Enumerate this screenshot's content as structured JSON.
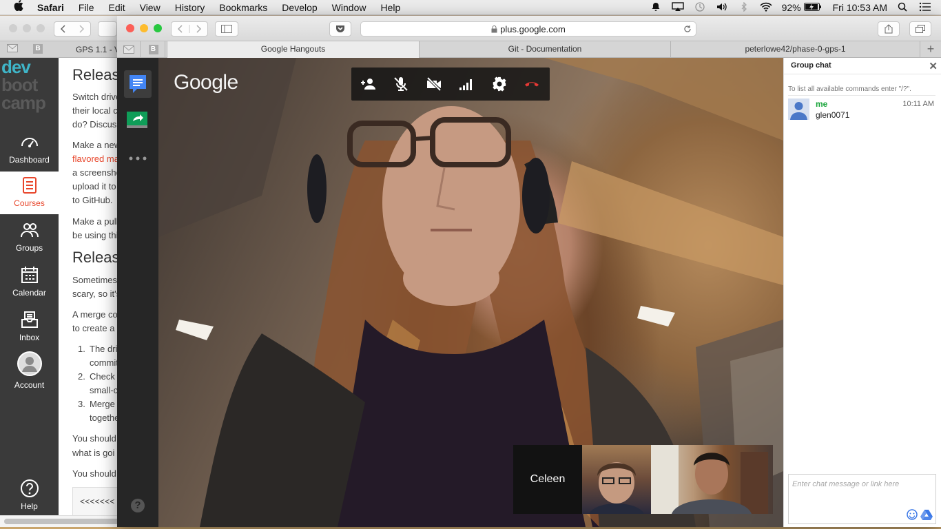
{
  "menubar": {
    "apple": "",
    "items": [
      "Safari",
      "File",
      "Edit",
      "View",
      "History",
      "Bookmarks",
      "Develop",
      "Window",
      "Help"
    ],
    "battery": "92%",
    "clock": "Fri 10:53 AM"
  },
  "background_window": {
    "tab_title": "GPS 1.1 - Ve",
    "pinned_badge": "B",
    "sidebar": {
      "logo_lines": [
        "dev",
        "boot",
        "camp"
      ],
      "items": [
        {
          "label": "Dashboard",
          "icon": "gauge-icon"
        },
        {
          "label": "Courses",
          "icon": "notebook-icon"
        },
        {
          "label": "Groups",
          "icon": "people-icon"
        },
        {
          "label": "Calendar",
          "icon": "calendar-icon"
        },
        {
          "label": "Inbox",
          "icon": "inbox-icon"
        },
        {
          "label": "Account",
          "icon": "account-icon"
        },
        {
          "label": "Help",
          "icon": "help-icon"
        }
      ]
    },
    "content": {
      "heading1": "Releas",
      "p1": [
        "Switch drive",
        "their local c",
        "do? Discus"
      ],
      "p2": [
        "Make a new",
        "flavored ma",
        "a screensho",
        "upload it to",
        "to GitHub."
      ],
      "p3": [
        "Make a pull",
        "be using thi"
      ],
      "heading2": "Releas",
      "p4": [
        "Sometimes",
        "scary, so it's"
      ],
      "p5": [
        "A merge co",
        "to create a"
      ],
      "list": [
        {
          "num": "1.",
          "lines": [
            "The driv",
            "commit"
          ]
        },
        {
          "num": "2.",
          "lines": [
            "Check",
            "small-c"
          ]
        },
        {
          "num": "3.",
          "lines": [
            "Merge",
            "togethe"
          ]
        }
      ],
      "p6": [
        "You should",
        "what is goi"
      ],
      "p7": "You should",
      "code": "<<<<<<<"
    }
  },
  "front_window": {
    "url": "plus.google.com",
    "pinned_badge": "B",
    "tabs": [
      {
        "title": "Google Hangouts",
        "active": true
      },
      {
        "title": "Git - Documentation",
        "active": false
      },
      {
        "title": "peterlowe42/phase-0-gps-1",
        "active": false
      }
    ]
  },
  "hangout": {
    "logo": "Google",
    "side_buttons": [
      "chat-icon",
      "screenshare-icon",
      "more-icon"
    ],
    "help_label": "?",
    "call_controls": [
      "invite-icon",
      "mic-mute-icon",
      "camera-off-icon",
      "bandwidth-icon",
      "settings-icon",
      "hangup-icon"
    ],
    "participants": [
      {
        "name": "Celeen",
        "video": false
      },
      {
        "name": "",
        "video": true
      },
      {
        "name": "",
        "video": true
      }
    ]
  },
  "group_chat": {
    "title": "Group chat",
    "help_text": "To list all available commands enter \"/?\".",
    "messages": [
      {
        "sender": "me",
        "time": "10:11 AM",
        "text": "glen0071"
      }
    ],
    "input_placeholder": "Enter chat message or link here"
  },
  "colors": {
    "dbc_accent": "#e8462b",
    "dbc_logo": "#3fb5c8",
    "chat_sender": "#18a43a",
    "hangup": "#e53935"
  }
}
